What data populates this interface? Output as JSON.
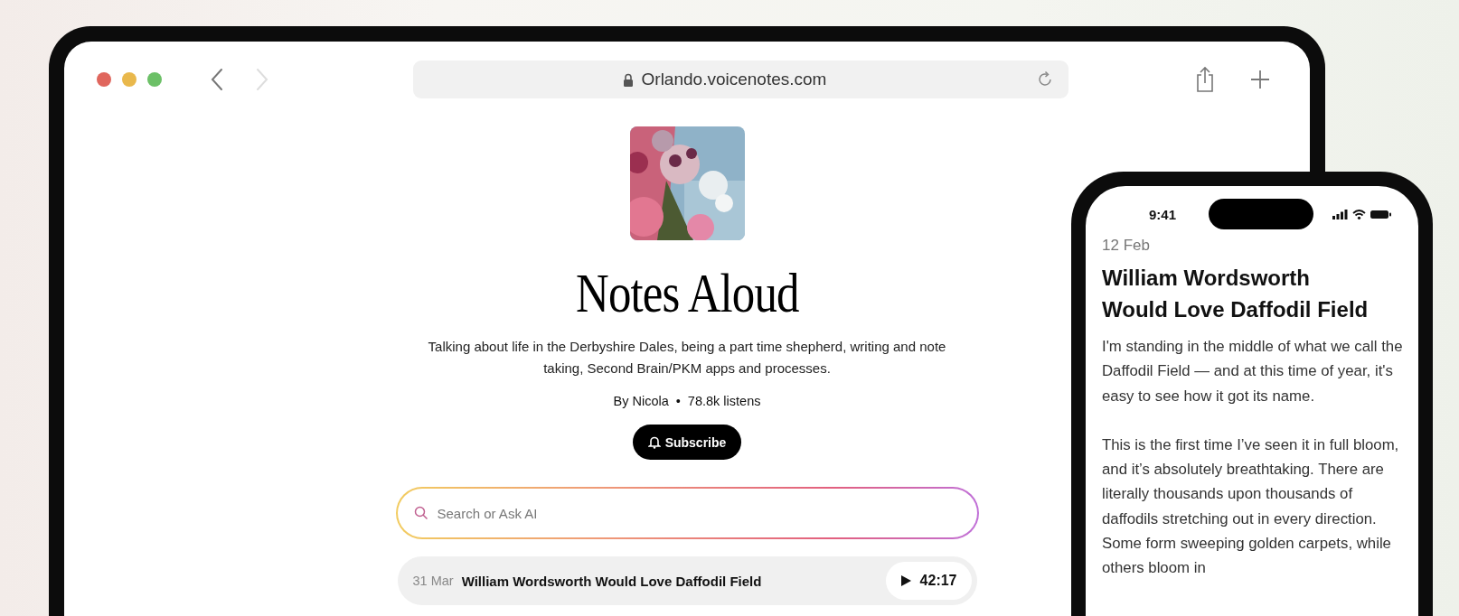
{
  "browser": {
    "url": "Orlando.voicenotes.com"
  },
  "podcast": {
    "title": "Notes Aloud",
    "description": "Talking about life in the Derbyshire Dales, being a part time shepherd, writing and note taking, Second Brain/PKM apps and processes.",
    "author": "By Nicola",
    "separator": "•",
    "listens": "78.8k listens",
    "subscribe": "Subscribe"
  },
  "search": {
    "placeholder": "Search or Ask AI"
  },
  "episodes": [
    {
      "date": "31 Mar",
      "title": "William Wordsworth Would Love Daffodil Field",
      "duration": "42:17"
    }
  ],
  "phone": {
    "time": "9:41",
    "date": "12 Feb",
    "title": "William Wordsworth Would Love Daffodil Field",
    "paragraphs": [
      "I'm standing in the middle of what we call the Daffodil Field — and at this time of year, it's easy to see how it got its name.",
      "This is the first time I’ve seen it in full bloom, and it’s absolutely breathtaking. There are literally thousands upon thousands of daffodils stretching out in every direction. Some form sweeping golden carpets, while others bloom in"
    ]
  }
}
